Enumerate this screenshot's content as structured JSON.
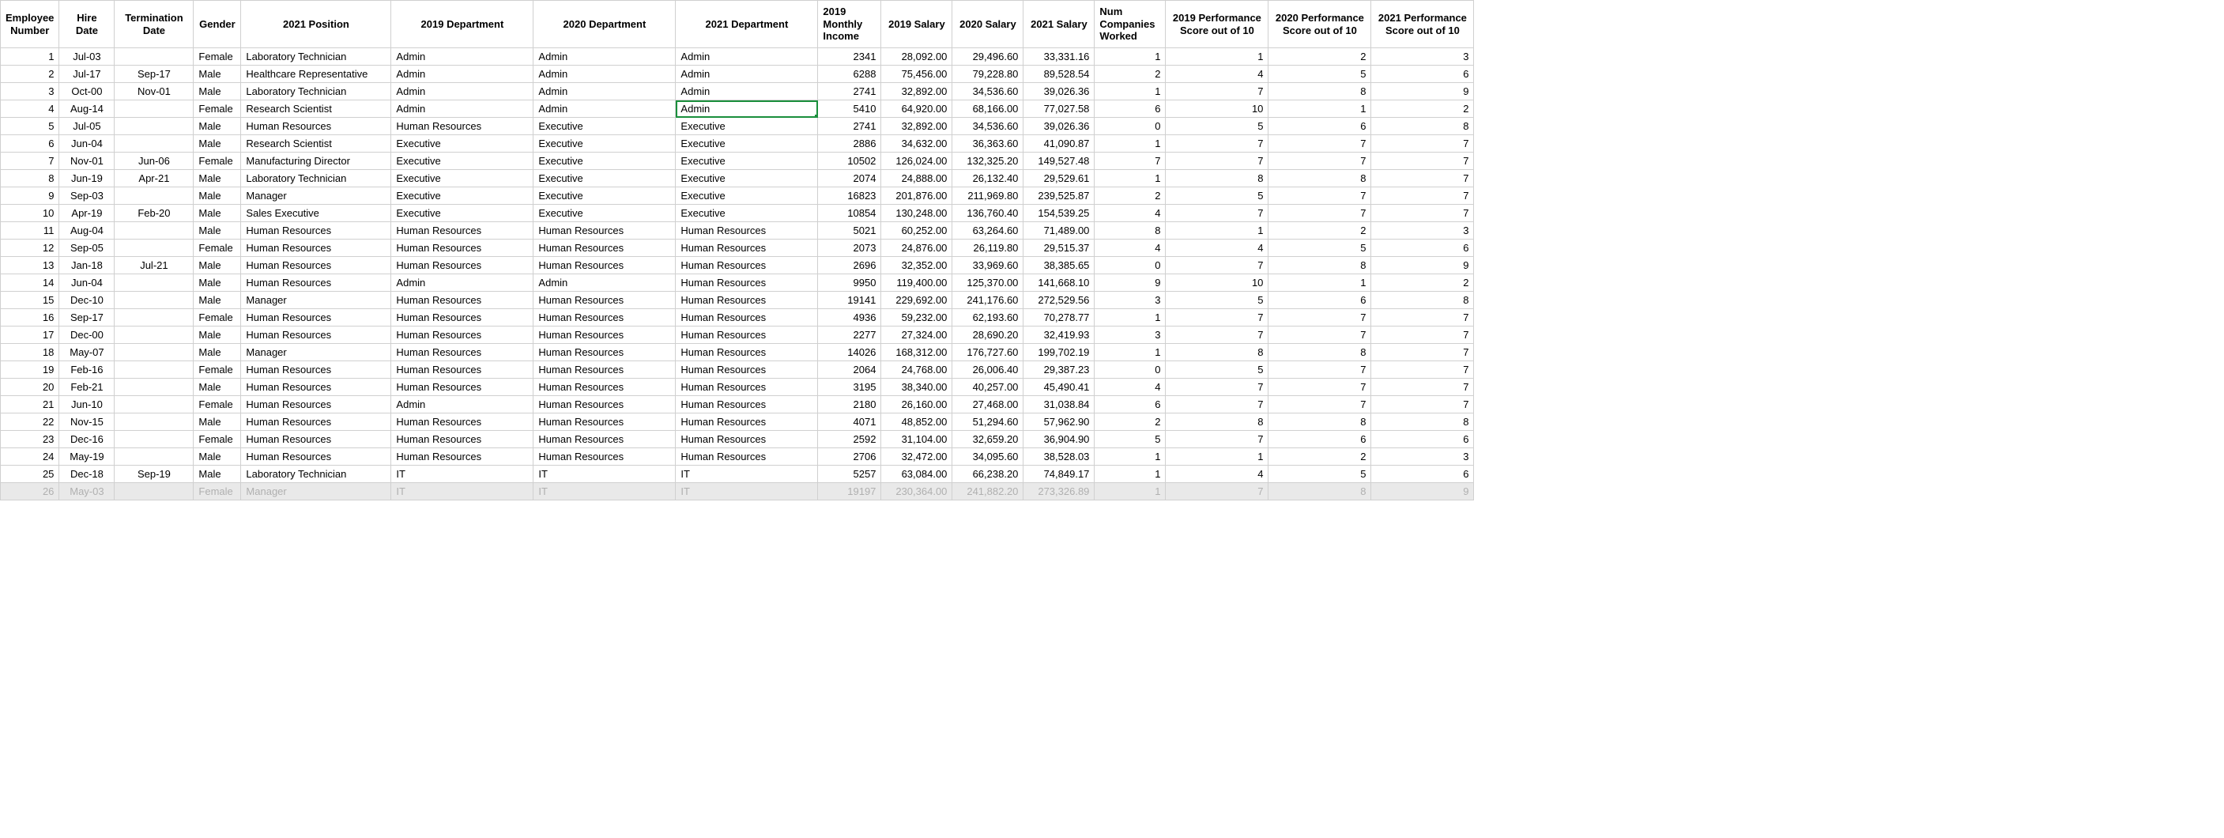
{
  "headers": [
    "Employee Number",
    "Hire Date",
    "Termination Date",
    "Gender",
    "2021 Position",
    "2019 Department",
    "2020 Department",
    "2021 Department",
    "2019 Monthly Income",
    "2019 Salary",
    "2020 Salary",
    "2021 Salary",
    "Num Companies Worked",
    "2019 Performance Score out of 10",
    "2020 Performance Score out of 10",
    "2021 Performance Score out of 10"
  ],
  "selected": {
    "row": 4,
    "col": "dept2021"
  },
  "greyed_row": 26,
  "rows": [
    {
      "emp": "1",
      "hire": "Jul-03",
      "term": "",
      "gender": "Female",
      "position": "Laboratory Technician",
      "dept2019": "Admin",
      "dept2020": "Admin",
      "dept2021": "Admin",
      "mi": "2341",
      "s19": "28,092.00",
      "s20": "29,496.60",
      "s21": "33,331.16",
      "nc": "1",
      "p19": "1",
      "p20": "2",
      "p21": "3"
    },
    {
      "emp": "2",
      "hire": "Jul-17",
      "term": "Sep-17",
      "gender": "Male",
      "position": "Healthcare Representative",
      "dept2019": "Admin",
      "dept2020": "Admin",
      "dept2021": "Admin",
      "mi": "6288",
      "s19": "75,456.00",
      "s20": "79,228.80",
      "s21": "89,528.54",
      "nc": "2",
      "p19": "4",
      "p20": "5",
      "p21": "6"
    },
    {
      "emp": "3",
      "hire": "Oct-00",
      "term": "Nov-01",
      "gender": "Male",
      "position": "Laboratory Technician",
      "dept2019": "Admin",
      "dept2020": "Admin",
      "dept2021": "Admin",
      "mi": "2741",
      "s19": "32,892.00",
      "s20": "34,536.60",
      "s21": "39,026.36",
      "nc": "1",
      "p19": "7",
      "p20": "8",
      "p21": "9"
    },
    {
      "emp": "4",
      "hire": "Aug-14",
      "term": "",
      "gender": "Female",
      "position": "Research Scientist",
      "dept2019": "Admin",
      "dept2020": "Admin",
      "dept2021": "Admin",
      "mi": "5410",
      "s19": "64,920.00",
      "s20": "68,166.00",
      "s21": "77,027.58",
      "nc": "6",
      "p19": "10",
      "p20": "1",
      "p21": "2"
    },
    {
      "emp": "5",
      "hire": "Jul-05",
      "term": "",
      "gender": "Male",
      "position": "Human Resources",
      "dept2019": "Human Resources",
      "dept2020": "Executive",
      "dept2021": "Executive",
      "mi": "2741",
      "s19": "32,892.00",
      "s20": "34,536.60",
      "s21": "39,026.36",
      "nc": "0",
      "p19": "5",
      "p20": "6",
      "p21": "8"
    },
    {
      "emp": "6",
      "hire": "Jun-04",
      "term": "",
      "gender": "Male",
      "position": "Research Scientist",
      "dept2019": "Executive",
      "dept2020": "Executive",
      "dept2021": "Executive",
      "mi": "2886",
      "s19": "34,632.00",
      "s20": "36,363.60",
      "s21": "41,090.87",
      "nc": "1",
      "p19": "7",
      "p20": "7",
      "p21": "7"
    },
    {
      "emp": "7",
      "hire": "Nov-01",
      "term": "Jun-06",
      "gender": "Female",
      "position": "Manufacturing Director",
      "dept2019": "Executive",
      "dept2020": "Executive",
      "dept2021": "Executive",
      "mi": "10502",
      "s19": "126,024.00",
      "s20": "132,325.20",
      "s21": "149,527.48",
      "nc": "7",
      "p19": "7",
      "p20": "7",
      "p21": "7"
    },
    {
      "emp": "8",
      "hire": "Jun-19",
      "term": "Apr-21",
      "gender": "Male",
      "position": "Laboratory Technician",
      "dept2019": "Executive",
      "dept2020": "Executive",
      "dept2021": "Executive",
      "mi": "2074",
      "s19": "24,888.00",
      "s20": "26,132.40",
      "s21": "29,529.61",
      "nc": "1",
      "p19": "8",
      "p20": "8",
      "p21": "7"
    },
    {
      "emp": "9",
      "hire": "Sep-03",
      "term": "",
      "gender": "Male",
      "position": "Manager",
      "dept2019": "Executive",
      "dept2020": "Executive",
      "dept2021": "Executive",
      "mi": "16823",
      "s19": "201,876.00",
      "s20": "211,969.80",
      "s21": "239,525.87",
      "nc": "2",
      "p19": "5",
      "p20": "7",
      "p21": "7"
    },
    {
      "emp": "10",
      "hire": "Apr-19",
      "term": "Feb-20",
      "gender": "Male",
      "position": "Sales Executive",
      "dept2019": "Executive",
      "dept2020": "Executive",
      "dept2021": "Executive",
      "mi": "10854",
      "s19": "130,248.00",
      "s20": "136,760.40",
      "s21": "154,539.25",
      "nc": "4",
      "p19": "7",
      "p20": "7",
      "p21": "7"
    },
    {
      "emp": "11",
      "hire": "Aug-04",
      "term": "",
      "gender": "Male",
      "position": "Human Resources",
      "dept2019": "Human Resources",
      "dept2020": "Human Resources",
      "dept2021": "Human Resources",
      "mi": "5021",
      "s19": "60,252.00",
      "s20": "63,264.60",
      "s21": "71,489.00",
      "nc": "8",
      "p19": "1",
      "p20": "2",
      "p21": "3"
    },
    {
      "emp": "12",
      "hire": "Sep-05",
      "term": "",
      "gender": "Female",
      "position": "Human Resources",
      "dept2019": "Human Resources",
      "dept2020": "Human Resources",
      "dept2021": "Human Resources",
      "mi": "2073",
      "s19": "24,876.00",
      "s20": "26,119.80",
      "s21": "29,515.37",
      "nc": "4",
      "p19": "4",
      "p20": "5",
      "p21": "6"
    },
    {
      "emp": "13",
      "hire": "Jan-18",
      "term": "Jul-21",
      "gender": "Male",
      "position": "Human Resources",
      "dept2019": "Human Resources",
      "dept2020": "Human Resources",
      "dept2021": "Human Resources",
      "mi": "2696",
      "s19": "32,352.00",
      "s20": "33,969.60",
      "s21": "38,385.65",
      "nc": "0",
      "p19": "7",
      "p20": "8",
      "p21": "9"
    },
    {
      "emp": "14",
      "hire": "Jun-04",
      "term": "",
      "gender": "Male",
      "position": "Human Resources",
      "dept2019": "Admin",
      "dept2020": "Admin",
      "dept2021": "Human Resources",
      "mi": "9950",
      "s19": "119,400.00",
      "s20": "125,370.00",
      "s21": "141,668.10",
      "nc": "9",
      "p19": "10",
      "p20": "1",
      "p21": "2"
    },
    {
      "emp": "15",
      "hire": "Dec-10",
      "term": "",
      "gender": "Male",
      "position": "Manager",
      "dept2019": "Human Resources",
      "dept2020": "Human Resources",
      "dept2021": "Human Resources",
      "mi": "19141",
      "s19": "229,692.00",
      "s20": "241,176.60",
      "s21": "272,529.56",
      "nc": "3",
      "p19": "5",
      "p20": "6",
      "p21": "8"
    },
    {
      "emp": "16",
      "hire": "Sep-17",
      "term": "",
      "gender": "Female",
      "position": "Human Resources",
      "dept2019": "Human Resources",
      "dept2020": "Human Resources",
      "dept2021": "Human Resources",
      "mi": "4936",
      "s19": "59,232.00",
      "s20": "62,193.60",
      "s21": "70,278.77",
      "nc": "1",
      "p19": "7",
      "p20": "7",
      "p21": "7"
    },
    {
      "emp": "17",
      "hire": "Dec-00",
      "term": "",
      "gender": "Male",
      "position": "Human Resources",
      "dept2019": "Human Resources",
      "dept2020": "Human Resources",
      "dept2021": "Human Resources",
      "mi": "2277",
      "s19": "27,324.00",
      "s20": "28,690.20",
      "s21": "32,419.93",
      "nc": "3",
      "p19": "7",
      "p20": "7",
      "p21": "7"
    },
    {
      "emp": "18",
      "hire": "May-07",
      "term": "",
      "gender": "Male",
      "position": "Manager",
      "dept2019": "Human Resources",
      "dept2020": "Human Resources",
      "dept2021": "Human Resources",
      "mi": "14026",
      "s19": "168,312.00",
      "s20": "176,727.60",
      "s21": "199,702.19",
      "nc": "1",
      "p19": "8",
      "p20": "8",
      "p21": "7"
    },
    {
      "emp": "19",
      "hire": "Feb-16",
      "term": "",
      "gender": "Female",
      "position": "Human Resources",
      "dept2019": "Human Resources",
      "dept2020": "Human Resources",
      "dept2021": "Human Resources",
      "mi": "2064",
      "s19": "24,768.00",
      "s20": "26,006.40",
      "s21": "29,387.23",
      "nc": "0",
      "p19": "5",
      "p20": "7",
      "p21": "7"
    },
    {
      "emp": "20",
      "hire": "Feb-21",
      "term": "",
      "gender": "Male",
      "position": "Human Resources",
      "dept2019": "Human Resources",
      "dept2020": "Human Resources",
      "dept2021": "Human Resources",
      "mi": "3195",
      "s19": "38,340.00",
      "s20": "40,257.00",
      "s21": "45,490.41",
      "nc": "4",
      "p19": "7",
      "p20": "7",
      "p21": "7"
    },
    {
      "emp": "21",
      "hire": "Jun-10",
      "term": "",
      "gender": "Female",
      "position": "Human Resources",
      "dept2019": "Admin",
      "dept2020": "Human Resources",
      "dept2021": "Human Resources",
      "mi": "2180",
      "s19": "26,160.00",
      "s20": "27,468.00",
      "s21": "31,038.84",
      "nc": "6",
      "p19": "7",
      "p20": "7",
      "p21": "7"
    },
    {
      "emp": "22",
      "hire": "Nov-15",
      "term": "",
      "gender": "Male",
      "position": "Human Resources",
      "dept2019": "Human Resources",
      "dept2020": "Human Resources",
      "dept2021": "Human Resources",
      "mi": "4071",
      "s19": "48,852.00",
      "s20": "51,294.60",
      "s21": "57,962.90",
      "nc": "2",
      "p19": "8",
      "p20": "8",
      "p21": "8"
    },
    {
      "emp": "23",
      "hire": "Dec-16",
      "term": "",
      "gender": "Female",
      "position": "Human Resources",
      "dept2019": "Human Resources",
      "dept2020": "Human Resources",
      "dept2021": "Human Resources",
      "mi": "2592",
      "s19": "31,104.00",
      "s20": "32,659.20",
      "s21": "36,904.90",
      "nc": "5",
      "p19": "7",
      "p20": "6",
      "p21": "6"
    },
    {
      "emp": "24",
      "hire": "May-19",
      "term": "",
      "gender": "Male",
      "position": "Human Resources",
      "dept2019": "Human Resources",
      "dept2020": "Human Resources",
      "dept2021": "Human Resources",
      "mi": "2706",
      "s19": "32,472.00",
      "s20": "34,095.60",
      "s21": "38,528.03",
      "nc": "1",
      "p19": "1",
      "p20": "2",
      "p21": "3"
    },
    {
      "emp": "25",
      "hire": "Dec-18",
      "term": "Sep-19",
      "gender": "Male",
      "position": "Laboratory Technician",
      "dept2019": "IT",
      "dept2020": "IT",
      "dept2021": "IT",
      "mi": "5257",
      "s19": "63,084.00",
      "s20": "66,238.20",
      "s21": "74,849.17",
      "nc": "1",
      "p19": "4",
      "p20": "5",
      "p21": "6"
    },
    {
      "emp": "26",
      "hire": "May-03",
      "term": "",
      "gender": "Female",
      "position": "Manager",
      "dept2019": "IT",
      "dept2020": "IT",
      "dept2021": "IT",
      "mi": "19197",
      "s19": "230,364.00",
      "s20": "241,882.20",
      "s21": "273,326.89",
      "nc": "1",
      "p19": "7",
      "p20": "8",
      "p21": "9"
    }
  ]
}
